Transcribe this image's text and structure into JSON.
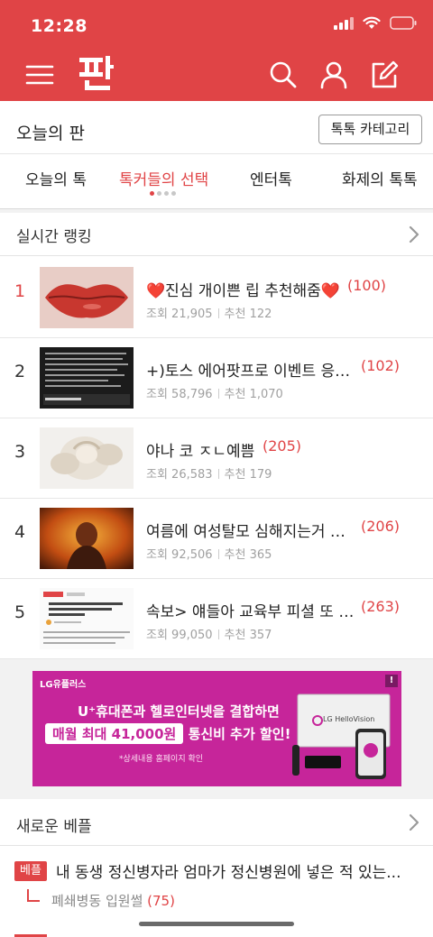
{
  "status_bar": {
    "time": "12:28"
  },
  "app": {
    "logo_text": "판",
    "colors": {
      "brand": "#e04446",
      "accent_text": "#e04446"
    }
  },
  "header_icons": [
    "menu-icon",
    "search-icon",
    "user-icon",
    "edit-icon"
  ],
  "today": {
    "title": "오늘의 판",
    "category_button": "톡톡 카테고리"
  },
  "tabs": [
    {
      "label": "오늘의 톡",
      "active": false
    },
    {
      "label": "톡커들의 선택",
      "active": true
    },
    {
      "label": "엔터톡",
      "active": false
    },
    {
      "label": "화제의 톡톡",
      "active": false
    }
  ],
  "ranking": {
    "title": "실시간 랭킹",
    "items": [
      {
        "rank": "1",
        "title": "❤️진심 개이쁜 립 추천해줌❤️",
        "comments": "(100)",
        "views_label": "조회 21,905",
        "recommend_label": "추천 122"
      },
      {
        "rank": "2",
        "title": "+)토스 에어팟프로 이벤트 응모...",
        "comments": "(102)",
        "views_label": "조회 58,796",
        "recommend_label": "추천 1,070"
      },
      {
        "rank": "3",
        "title": "야나 코 ㅈㄴ예쁨",
        "comments": "(205)",
        "views_label": "조회 26,583",
        "recommend_label": "추천 179"
      },
      {
        "rank": "4",
        "title": "여름에 여성탈모 심해지는거 알...",
        "comments": "(206)",
        "views_label": "조회 92,506",
        "recommend_label": "추천 365"
      },
      {
        "rank": "5",
        "title": "속보> 얘들아 교육부 피셜 또 뜸!!!!!!",
        "comments": "(263)",
        "views_label": "조회 99,050",
        "recommend_label": "추천 357"
      }
    ]
  },
  "ad": {
    "brand": "LG유플러스",
    "line1": "U⁺휴대폰과 헬로인터넷을 결합하면",
    "line2_highlight": "매월 최대 41,000원",
    "line2_rest": "통신비 추가 할인!",
    "note": "*상세내용 홈페이지 확인",
    "tv_brand": "LG HelloVision",
    "info": "!"
  },
  "new_best": {
    "title": "새로운 베플",
    "tag": "베플",
    "post_title": "내 동생 정신병자라 엄마가 정신병원에 넣은 적 있는...",
    "sub_text": "폐쇄병동 입원썰",
    "sub_count": "(75)"
  }
}
